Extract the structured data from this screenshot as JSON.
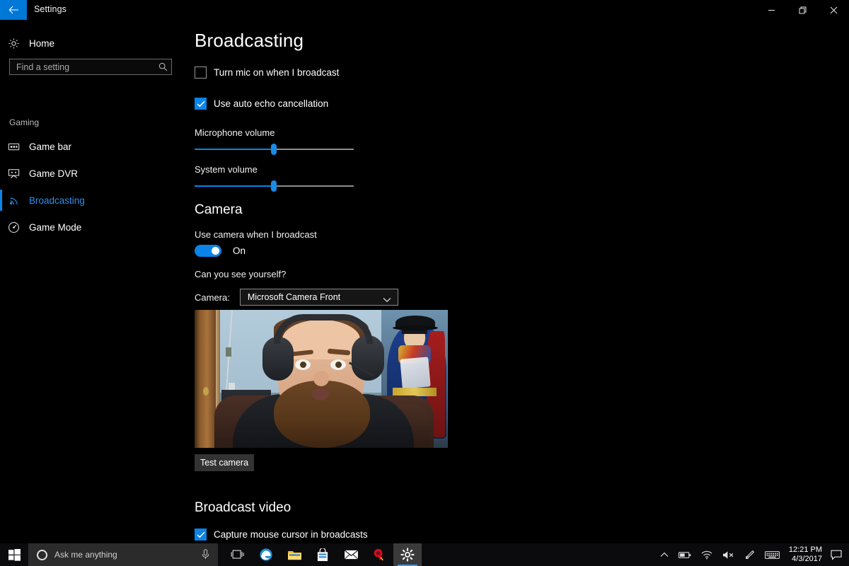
{
  "window": {
    "title": "Settings",
    "back_icon": "back-arrow-icon",
    "minimize_label": "Minimize",
    "maximize_label": "Restore",
    "close_label": "Close",
    "accent_color": "#0078d7"
  },
  "sidebar": {
    "home": {
      "label": "Home",
      "icon": "home-gear-icon"
    },
    "search": {
      "placeholder": "Find a setting",
      "value": "",
      "icon": "search-icon"
    },
    "group_label": "Gaming",
    "items": [
      {
        "label": "Game bar",
        "icon": "game-bar-icon",
        "selected": false
      },
      {
        "label": "Game DVR",
        "icon": "game-dvr-icon",
        "selected": false
      },
      {
        "label": "Broadcasting",
        "icon": "broadcasting-icon",
        "selected": true
      },
      {
        "label": "Game Mode",
        "icon": "game-mode-icon",
        "selected": false
      }
    ],
    "selected_color": "#2e8fe8"
  },
  "main": {
    "page_title": "Broadcasting",
    "mic_checkbox": {
      "label": "Turn mic on when I broadcast",
      "checked": false
    },
    "echo_checkbox": {
      "label": "Use auto echo cancellation",
      "checked": true
    },
    "mic_volume": {
      "label": "Microphone volume",
      "value": 50
    },
    "system_volume": {
      "label": "System volume",
      "value": 50
    },
    "camera_section": {
      "title": "Camera",
      "use_camera_label": "Use camera when I broadcast",
      "toggle_state": "On",
      "see_yourself_label": "Can you see yourself?",
      "camera_field_label": "Camera:",
      "camera_selected": "Microsoft Camera Front",
      "camera_options": [
        "Microsoft Camera Front"
      ],
      "test_button": "Test camera"
    },
    "broadcast_video_section": {
      "title": "Broadcast video",
      "cursor_checkbox": {
        "label": "Capture mouse cursor in broadcasts",
        "checked": true
      }
    },
    "accent_color": "#0a84e8"
  },
  "taskbar": {
    "start": {
      "icon": "windows-start-icon"
    },
    "cortana": {
      "placeholder": "Ask me anything",
      "value": "",
      "ring_icon": "cortana-ring-icon",
      "mic_icon": "microphone-icon"
    },
    "apps": [
      {
        "name": "task-view",
        "icon": "task-view-icon",
        "active": false
      },
      {
        "name": "edge",
        "icon": "edge-browser-icon",
        "active": false
      },
      {
        "name": "file-explorer",
        "icon": "file-explorer-icon",
        "active": false
      },
      {
        "name": "microsoft-store",
        "icon": "store-icon",
        "active": false
      },
      {
        "name": "mail",
        "icon": "mail-icon",
        "active": false
      },
      {
        "name": "norton",
        "icon": "security-shield-icon",
        "active": false
      },
      {
        "name": "settings",
        "icon": "gear-icon",
        "active": true
      }
    ],
    "tray": [
      {
        "name": "show-hidden-icons",
        "icon": "chevron-up-icon"
      },
      {
        "name": "battery",
        "icon": "battery-icon"
      },
      {
        "name": "network",
        "icon": "wifi-icon"
      },
      {
        "name": "volume",
        "icon": "speaker-muted-icon"
      },
      {
        "name": "pen-workspace",
        "icon": "pen-icon"
      },
      {
        "name": "touch-keyboard",
        "icon": "keyboard-icon"
      }
    ],
    "clock": {
      "time": "12:21 PM",
      "date": "4/3/2017"
    },
    "action_center": {
      "icon": "notification-icon"
    }
  }
}
